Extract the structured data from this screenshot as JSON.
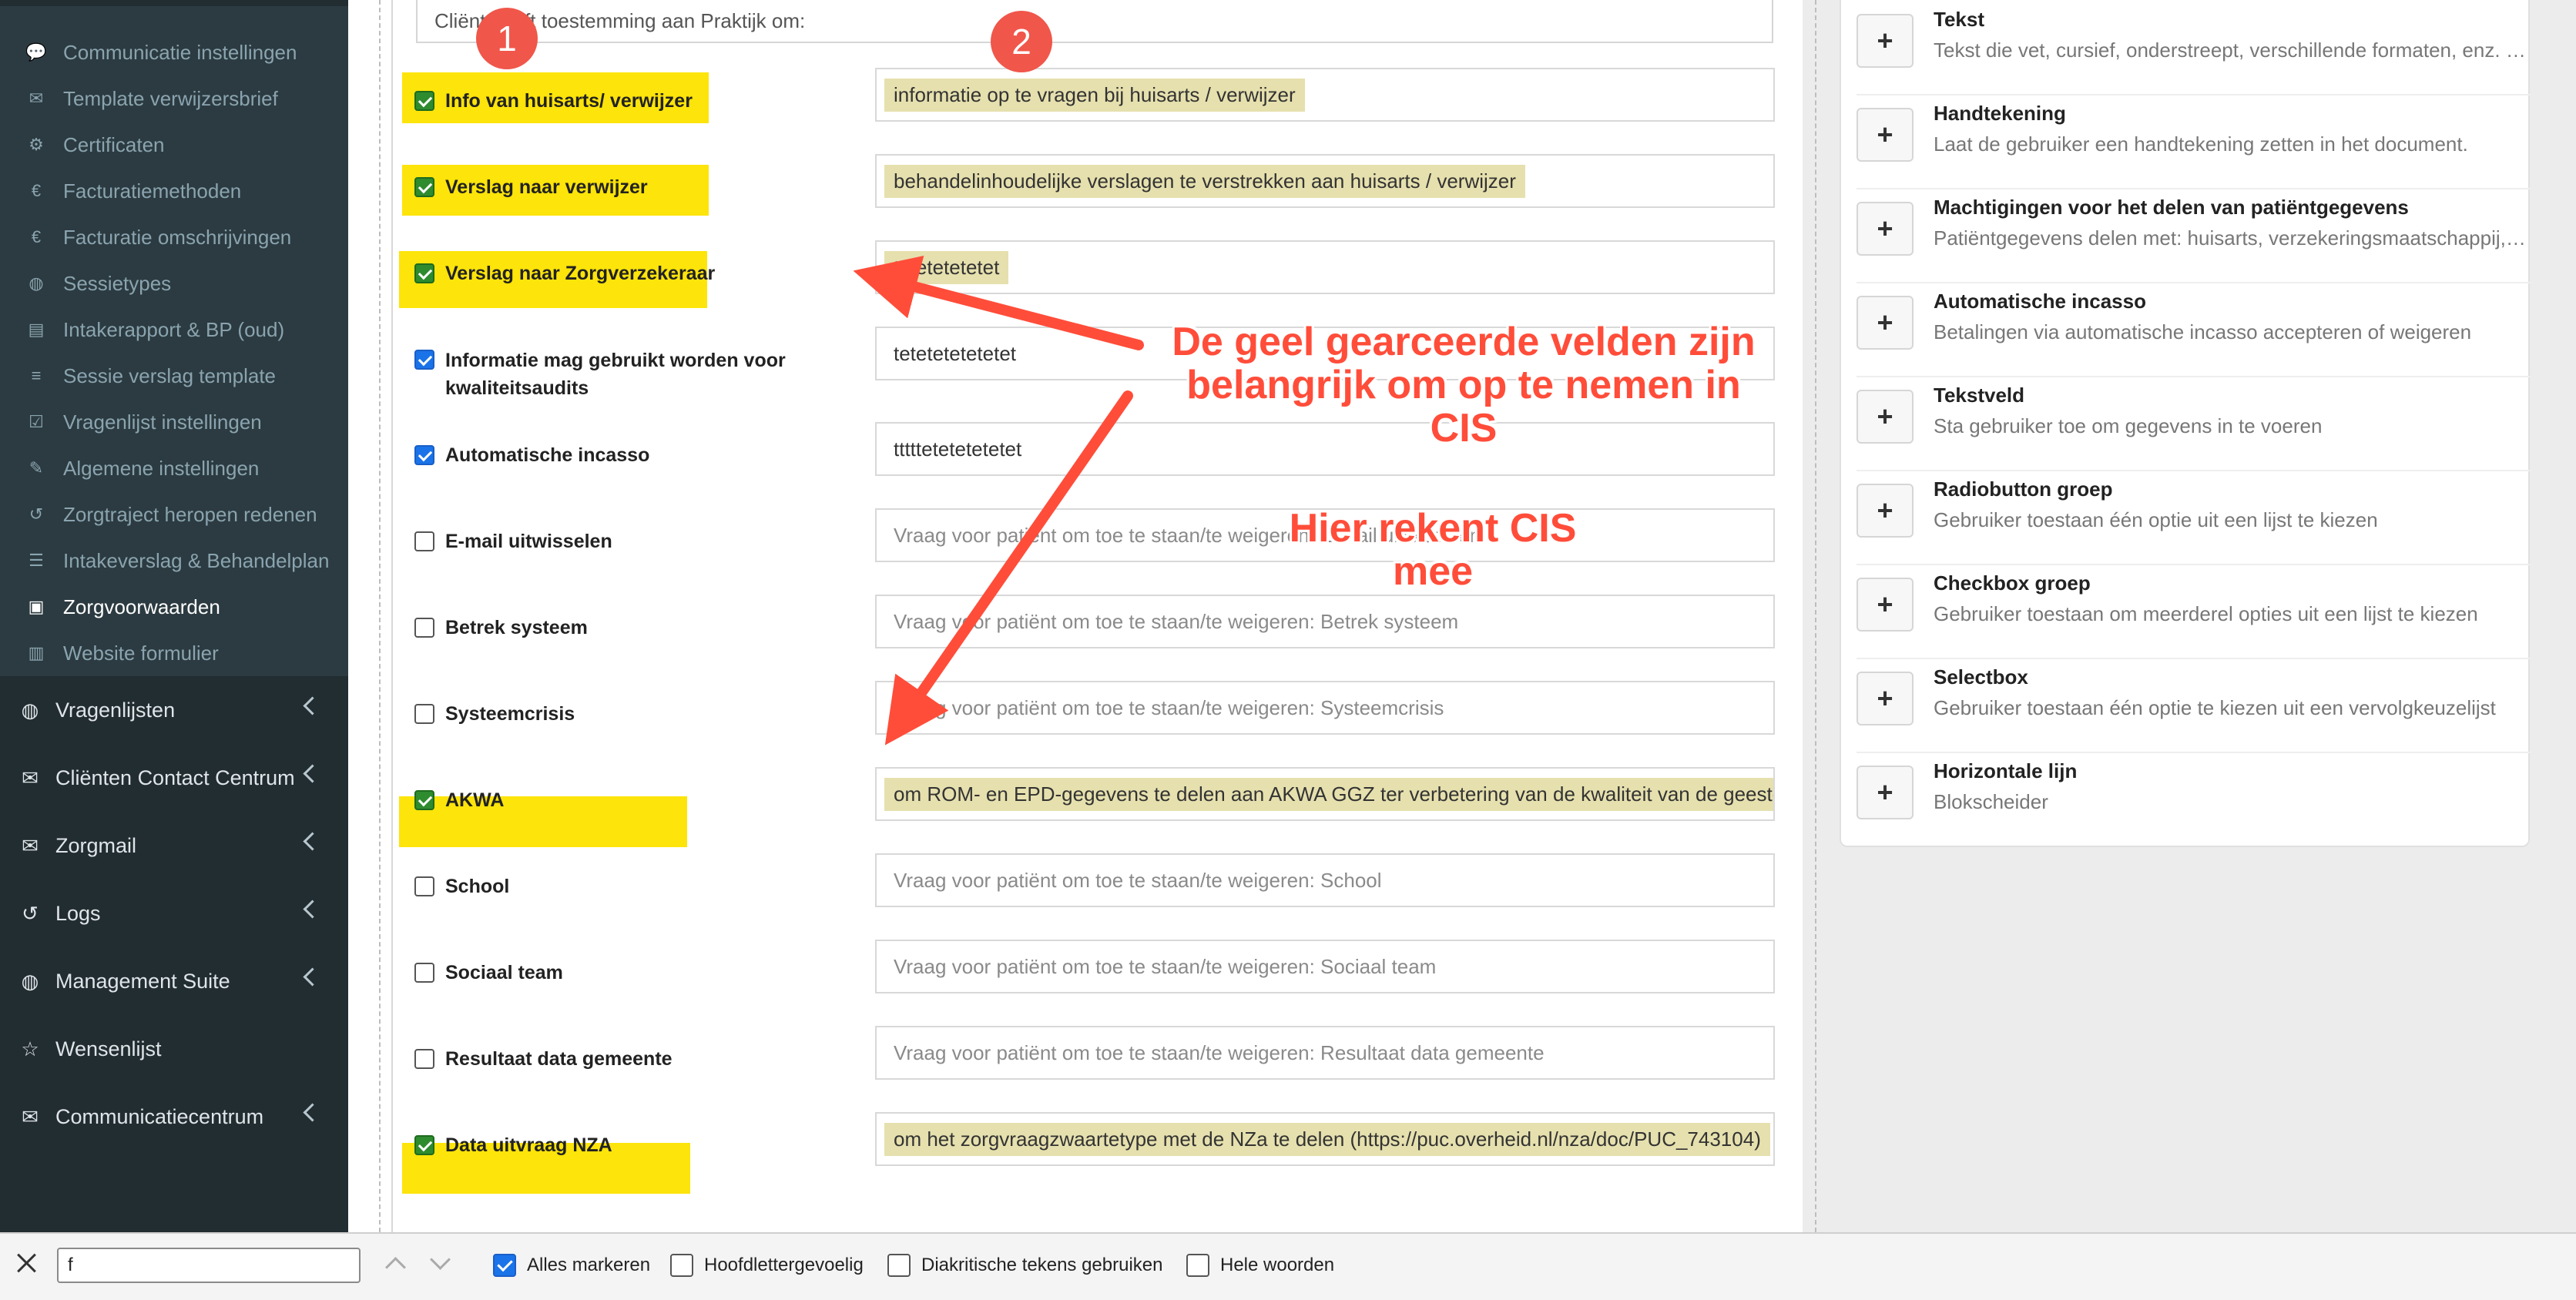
{
  "sidebar": {
    "sub_items": [
      {
        "label": "Communicatie instellingen",
        "icon": "chat-icon"
      },
      {
        "label": "Template verwijzersbrief",
        "icon": "envelope-icon"
      },
      {
        "label": "Certificaten",
        "icon": "gear-icon"
      },
      {
        "label": "Facturatiemethoden",
        "icon": "euro-icon"
      },
      {
        "label": "Facturatie omschrijvingen",
        "icon": "euro-icon"
      },
      {
        "label": "Sessietypes",
        "icon": "globe-icon"
      },
      {
        "label": "Intakerapport & BP (oud)",
        "icon": "document-icon"
      },
      {
        "label": "Sessie verslag template",
        "icon": "list-icon"
      },
      {
        "label": "Vragenlijst instellingen",
        "icon": "checklist-icon"
      },
      {
        "label": "Algemene instellingen",
        "icon": "wrench-icon"
      },
      {
        "label": "Zorgtraject heropen redenen",
        "icon": "undo-icon"
      },
      {
        "label": "Intakeverslag & Behandelplan",
        "icon": "sliders-icon"
      },
      {
        "label": "Zorgvoorwaarden",
        "icon": "pdf-icon"
      },
      {
        "label": "Website formulier",
        "icon": "briefcase-icon"
      }
    ],
    "main_items": [
      {
        "label": "Vragenlijsten",
        "icon": "globe-icon",
        "chevron": true
      },
      {
        "label": "Cliënten Contact Centrum",
        "icon": "envelope-icon",
        "chevron": true
      },
      {
        "label": "Zorgmail",
        "icon": "envelope-icon",
        "chevron": true
      },
      {
        "label": "Logs",
        "icon": "history-icon",
        "chevron": true
      },
      {
        "label": "Management Suite",
        "icon": "globe-icon",
        "chevron": true
      },
      {
        "label": "Wensenlijst",
        "icon": "star-icon",
        "chevron": false
      },
      {
        "label": "Communicatiecentrum",
        "icon": "envelope-icon",
        "chevron": true
      }
    ]
  },
  "form": {
    "top_text": "Cliënt geeft toestemming aan Praktijk om:",
    "rows": [
      {
        "label": "Info van huisarts/ verwijzer",
        "checked": true,
        "highlighted": true,
        "value": "informatie op te vragen bij huisarts / verwijzer",
        "placeholder": ""
      },
      {
        "label": "Verslag naar verwijzer",
        "checked": true,
        "highlighted": true,
        "value": "behandelinhoudelijke verslagen te verstrekken aan huisarts / verwijzer",
        "placeholder": ""
      },
      {
        "label": "Verslag naar Zorgverzekeraar",
        "checked": true,
        "highlighted": true,
        "value": "tetetetetetet",
        "placeholder": ""
      },
      {
        "label": "Informatie mag gebruikt worden voor kwaliteitsaudits",
        "checked": true,
        "highlighted": false,
        "value": "tetetetetetetet",
        "placeholder": ""
      },
      {
        "label": "Automatische incasso",
        "checked": true,
        "highlighted": false,
        "value": "tttttetetetetetet",
        "placeholder": ""
      },
      {
        "label": "E-mail uitwisselen",
        "checked": false,
        "highlighted": false,
        "value": "",
        "placeholder": "Vraag voor patiënt om toe te staan/te weigeren: E-mail uitwisselen"
      },
      {
        "label": "Betrek systeem",
        "checked": false,
        "highlighted": false,
        "value": "",
        "placeholder": "Vraag voor patiënt om toe te staan/te weigeren: Betrek systeem"
      },
      {
        "label": "Systeemcrisis",
        "checked": false,
        "highlighted": false,
        "value": "",
        "placeholder": "Vraag voor patiënt om toe te staan/te weigeren: Systeemcrisis"
      },
      {
        "label": "AKWA",
        "checked": true,
        "highlighted": true,
        "value": "om ROM- en EPD-gegevens te delen aan AKWA GGZ ter verbetering van de kwaliteit van de geestelijke gezondheidszorg",
        "placeholder": ""
      },
      {
        "label": "School",
        "checked": false,
        "highlighted": false,
        "value": "",
        "placeholder": "Vraag voor patiënt om toe te staan/te weigeren: School"
      },
      {
        "label": "Sociaal team",
        "checked": false,
        "highlighted": false,
        "value": "",
        "placeholder": "Vraag voor patiënt om toe te staan/te weigeren: Sociaal team"
      },
      {
        "label": "Resultaat data gemeente",
        "checked": false,
        "highlighted": false,
        "value": "",
        "placeholder": "Vraag voor patiënt om toe te staan/te weigeren: Resultaat data gemeente"
      },
      {
        "label": "Data uitvraag NZA",
        "checked": true,
        "highlighted": true,
        "value": "om het zorgvraagzwaartetype met de NZa te delen (https://puc.overheid.nl/nza/doc/PUC_743104)",
        "placeholder": ""
      }
    ]
  },
  "components": [
    {
      "title": "Tekst",
      "description": "Tekst die vet, cursief, onderstreept, verschillende formaten, enz. kan bevatten."
    },
    {
      "title": "Handtekening",
      "description": "Laat de gebruiker een handtekening zetten in het document."
    },
    {
      "title": "Machtigingen voor het delen van patiëntgegevens",
      "description": "Patiëntgegevens delen met: huisarts, verzekeringsmaatschappij, ..."
    },
    {
      "title": "Automatische incasso",
      "description": "Betalingen via automatische incasso accepteren of weigeren"
    },
    {
      "title": "Tekstveld",
      "description": "Sta gebruiker toe om gegevens in te voeren"
    },
    {
      "title": "Radiobutton groep",
      "description": "Gebruiker toestaan één optie uit een lijst te kiezen"
    },
    {
      "title": "Checkbox groep",
      "description": "Gebruiker toestaan om meerderel opties uit een lijst te kiezen"
    },
    {
      "title": "Selectbox",
      "description": "Gebruiker toestaan één optie te kiezen uit een vervolgkeuzelijst"
    },
    {
      "title": "Horizontale lijn",
      "description": "Blokscheider"
    }
  ],
  "add_button_symbol": "+",
  "findbar": {
    "query": "f",
    "options": [
      {
        "label": "Alles markeren",
        "checked": true
      },
      {
        "label": "Hoofdlettergevoelig",
        "checked": false
      },
      {
        "label": "Diakritische tekens gebruiken",
        "checked": false
      },
      {
        "label": "Hele woorden",
        "checked": false
      }
    ]
  },
  "annotations": {
    "badge_1": "1",
    "badge_2": "2",
    "callout_main": "De geel gearceerde velden zijn belangrijk om op te nemen in CIS",
    "callout_sub": "Hier rekent CIS mee",
    "color": "#ff4d3a"
  },
  "colors": {
    "sidebar_bg": "#222d32",
    "sidebar_sub_bg": "#2c3b41",
    "highlight_yellow": "#fde40a",
    "field_highlight": "#e6e0ae",
    "checkbox_green": "#2e8b2e",
    "checkbox_blue": "#1a73e8"
  }
}
